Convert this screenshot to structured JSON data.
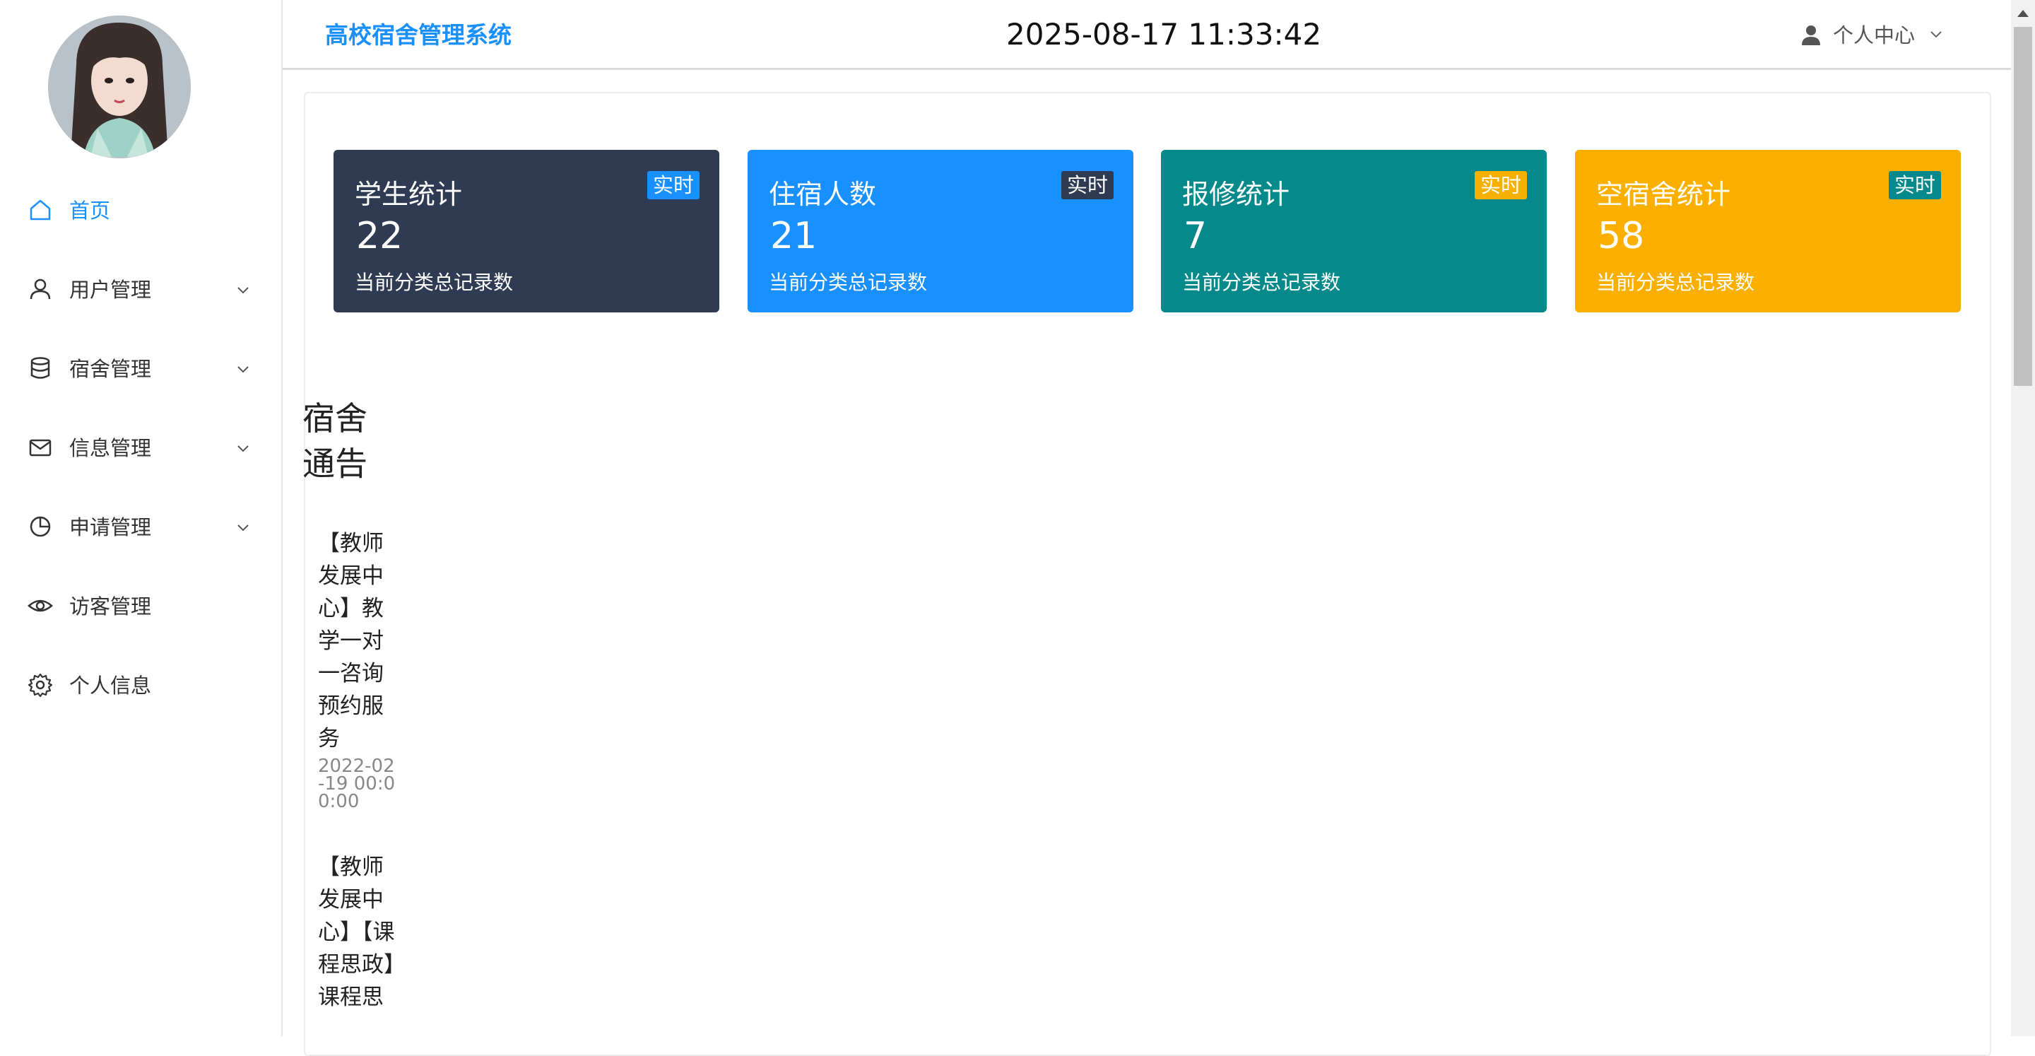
{
  "sidebar": {
    "items": [
      {
        "label": "首页",
        "icon": "home-icon"
      },
      {
        "label": "用户管理",
        "icon": "user-icon"
      },
      {
        "label": "宿舍管理",
        "icon": "database-icon"
      },
      {
        "label": "信息管理",
        "icon": "mail-icon"
      },
      {
        "label": "申请管理",
        "icon": "pie-chart-icon"
      },
      {
        "label": "访客管理",
        "icon": "eye-icon"
      },
      {
        "label": "个人信息",
        "icon": "gear-icon"
      }
    ]
  },
  "header": {
    "title": "高校宿舍管理系统",
    "datetime": "2025-08-17 11:33:42",
    "user_menu": "个人中心"
  },
  "stats": [
    {
      "title": "学生统计",
      "value": "22",
      "desc": "当前分类总记录数",
      "badge": "实时",
      "bg": "#2f3b52",
      "badge_bg": "#1890ff",
      "badge_fg": "#ffffff"
    },
    {
      "title": "住宿人数",
      "value": "21",
      "desc": "当前分类总记录数",
      "badge": "实时",
      "bg": "#1890ff",
      "badge_bg": "#2f3b52",
      "badge_fg": "#ffffff"
    },
    {
      "title": "报修统计",
      "value": "7",
      "desc": "当前分类总记录数",
      "badge": "实时",
      "bg": "#06898a",
      "badge_bg": "#f5b000",
      "badge_fg": "#ffffff"
    },
    {
      "title": "空宿舍统计",
      "value": "58",
      "desc": "当前分类总记录数",
      "badge": "实时",
      "bg": "#fbb000",
      "badge_bg": "#06898a",
      "badge_fg": "#ffffff"
    }
  ],
  "notices": {
    "title": "宿舍通告",
    "items": [
      {
        "text": "【教师发展中心】教学一对一咨询预约服务",
        "date": "2022-02-19 00:00:00"
      },
      {
        "text": "【教师发展中心】【课程思政】课程思",
        "date": ""
      }
    ]
  },
  "colors": {
    "accent": "#1890ff"
  }
}
